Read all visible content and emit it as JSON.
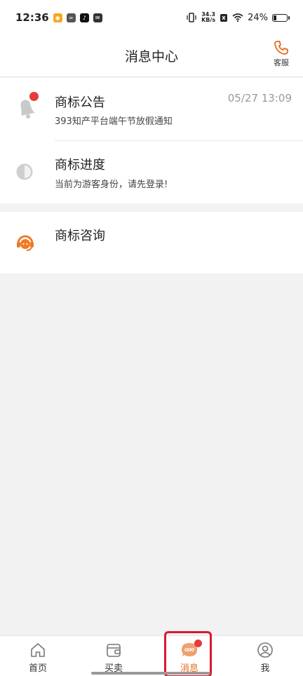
{
  "status_bar": {
    "time": "12:36",
    "speed_value": "34.3",
    "speed_unit": "KB/s",
    "battery": "24%",
    "battery_level": 0.24
  },
  "header": {
    "title": "消息中心",
    "service_label": "客服",
    "service_icon": "phone-icon"
  },
  "items": [
    {
      "title": "商标公告",
      "subtitle": "393知产平台端午节放假通知",
      "time": "05/27 13:09",
      "icon": "bell-icon",
      "unread": true
    },
    {
      "title": "商标进度",
      "subtitle": "当前为游客身份，请先登录!",
      "icon": "progress-icon"
    },
    {
      "title": "商标咨询",
      "icon": "headset-icon"
    }
  ],
  "tabbar": {
    "tabs": [
      {
        "label": "首页",
        "icon": "home-icon"
      },
      {
        "label": "买卖",
        "icon": "wallet-icon"
      },
      {
        "label": "消息",
        "icon": "chat-icon",
        "active": true,
        "badge": true
      },
      {
        "label": "我",
        "icon": "user-icon"
      }
    ]
  },
  "colors": {
    "accent": "#e46a1e",
    "badge": "#e53b3b",
    "highlight": "#d7192d"
  }
}
